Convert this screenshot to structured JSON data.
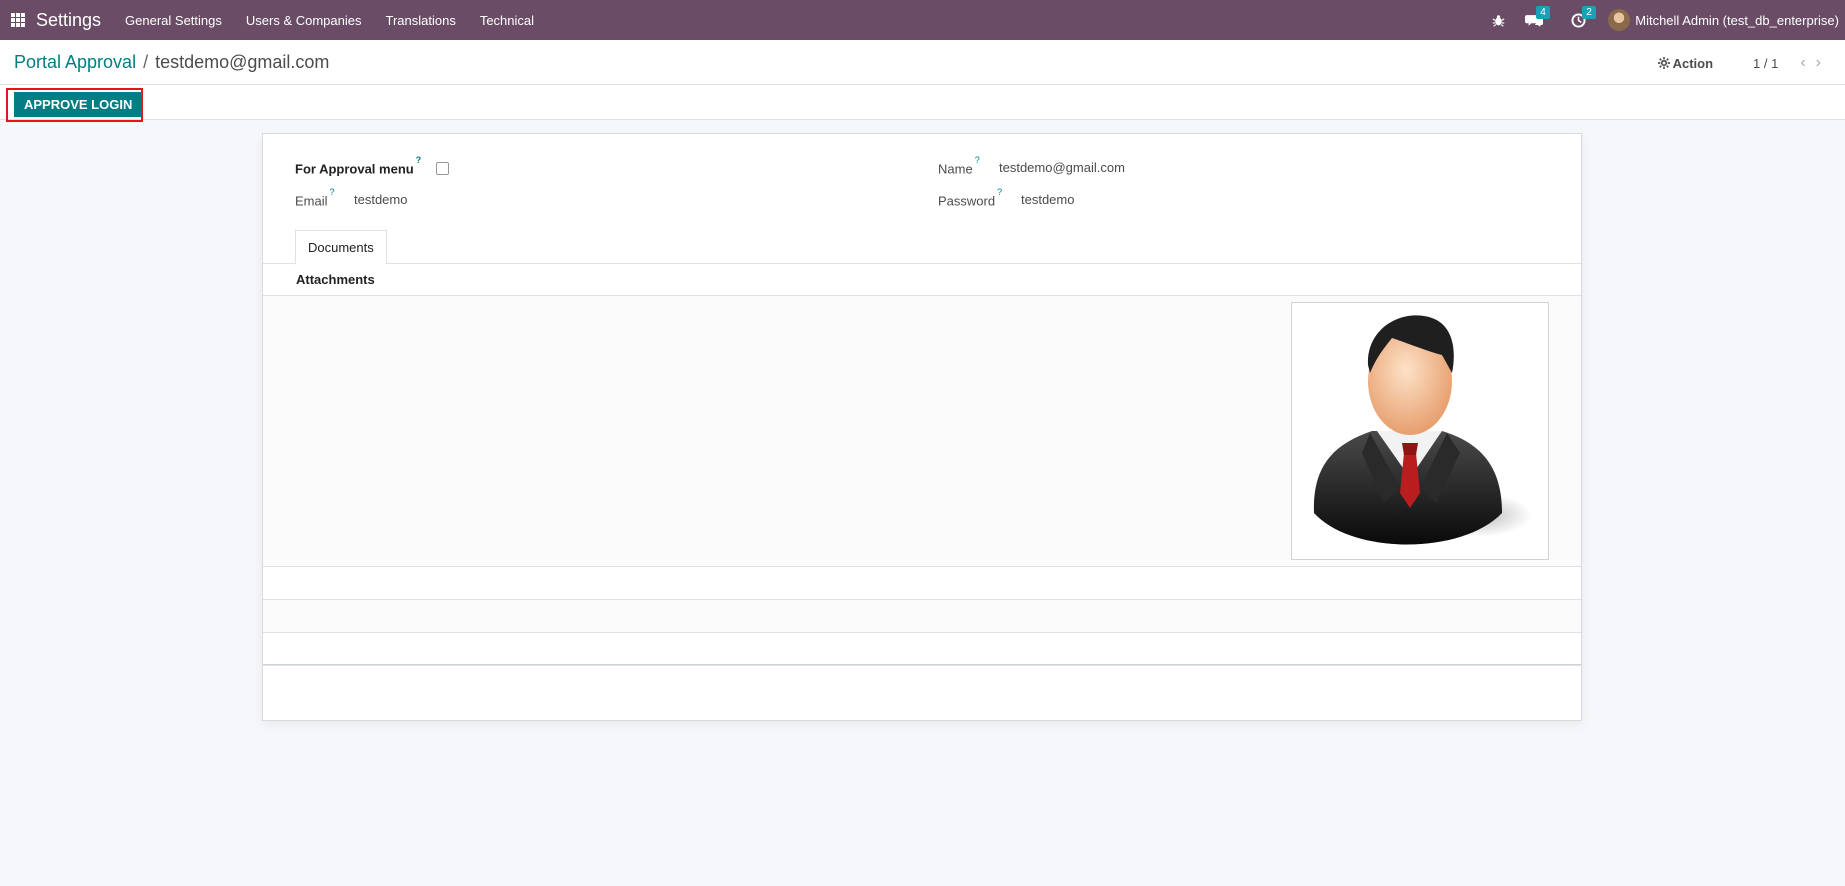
{
  "navbar": {
    "brand": "Settings",
    "menu": [
      "General Settings",
      "Users & Companies",
      "Translations",
      "Technical"
    ],
    "messages_count": "4",
    "activities_count": "2",
    "user": "Mitchell Admin (test_db_enterprise)",
    "color": "#6b4c66"
  },
  "control_panel": {
    "breadcrumb_parent": "Portal Approval",
    "breadcrumb_current": "testdemo@gmail.com",
    "action_label": "Action",
    "pager": "1 / 1",
    "approve_button": "APPROVE LOGIN"
  },
  "form": {
    "for_approval_label": "For Approval menu",
    "for_approval_checked": false,
    "email_label": "Email",
    "email_value": "testdemo",
    "name_label": "Name",
    "name_value": "testdemo@gmail.com",
    "password_label": "Password",
    "password_value": "testdemo",
    "help_mark": "?",
    "tab_documents": "Documents",
    "attachments_label": "Attachments"
  },
  "colors": {
    "accent": "#017e84",
    "highlight": "#e8141c"
  }
}
